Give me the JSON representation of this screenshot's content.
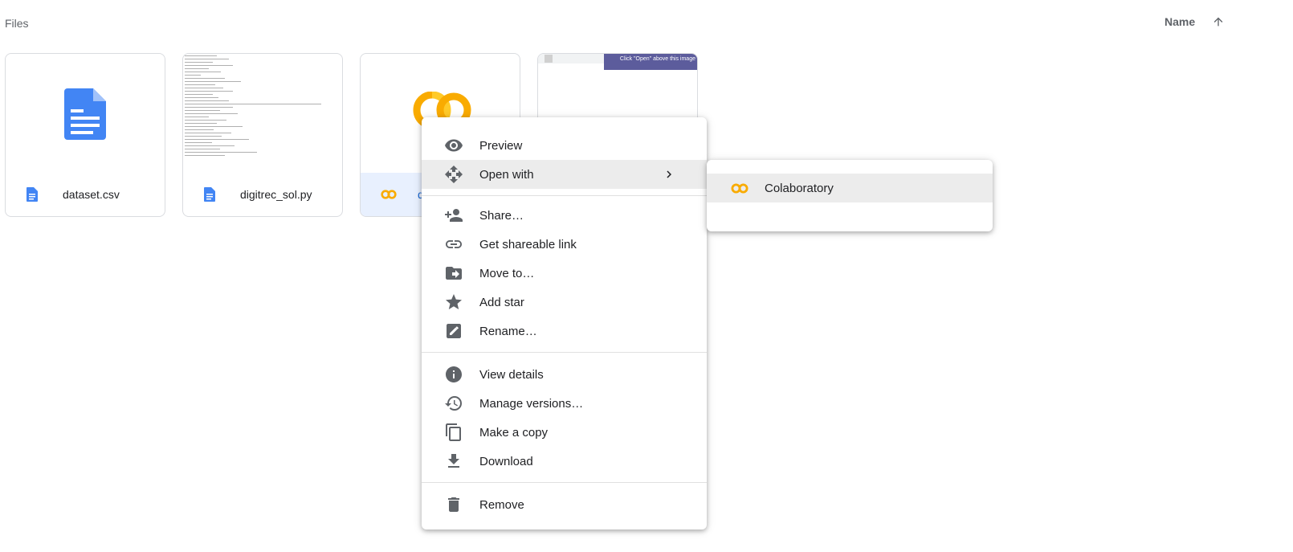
{
  "header": {
    "section_title": "Files",
    "sort_label": "Name"
  },
  "files": [
    {
      "name": "dataset.csv",
      "icon": "document-icon"
    },
    {
      "name": "digitrec_sol.py",
      "icon": "document-icon"
    },
    {
      "name": "dig",
      "icon": "colab-icon",
      "selected": true
    },
    {
      "name": "",
      "icon": "image-icon",
      "preview_text": "Click \"Open\" above this image"
    }
  ],
  "context_menu": {
    "items": [
      {
        "label": "Preview",
        "icon": "eye-icon"
      },
      {
        "label": "Open with",
        "icon": "move-arrows-icon"
      },
      {
        "label": "Share…",
        "icon": "person-add-icon"
      },
      {
        "label": "Get shareable link",
        "icon": "link-icon"
      },
      {
        "label": "Move to…",
        "icon": "folder-move-icon"
      },
      {
        "label": "Add star",
        "icon": "star-icon"
      },
      {
        "label": "Rename…",
        "icon": "edit-icon"
      },
      {
        "label": "View details",
        "icon": "info-icon"
      },
      {
        "label": "Manage versions…",
        "icon": "history-icon"
      },
      {
        "label": "Make a copy",
        "icon": "copy-icon"
      },
      {
        "label": "Download",
        "icon": "download-icon"
      },
      {
        "label": "Remove",
        "icon": "trash-icon"
      }
    ]
  },
  "submenu": {
    "items": [
      {
        "label": "Colaboratory",
        "icon": "colab-icon"
      }
    ]
  },
  "colors": {
    "doc_blue": "#4285f4",
    "colab_yellow": "#f9ab00",
    "selected_bg": "#e8f0fe",
    "hover_bg": "#ececec",
    "icon_gray": "#5f6368"
  }
}
